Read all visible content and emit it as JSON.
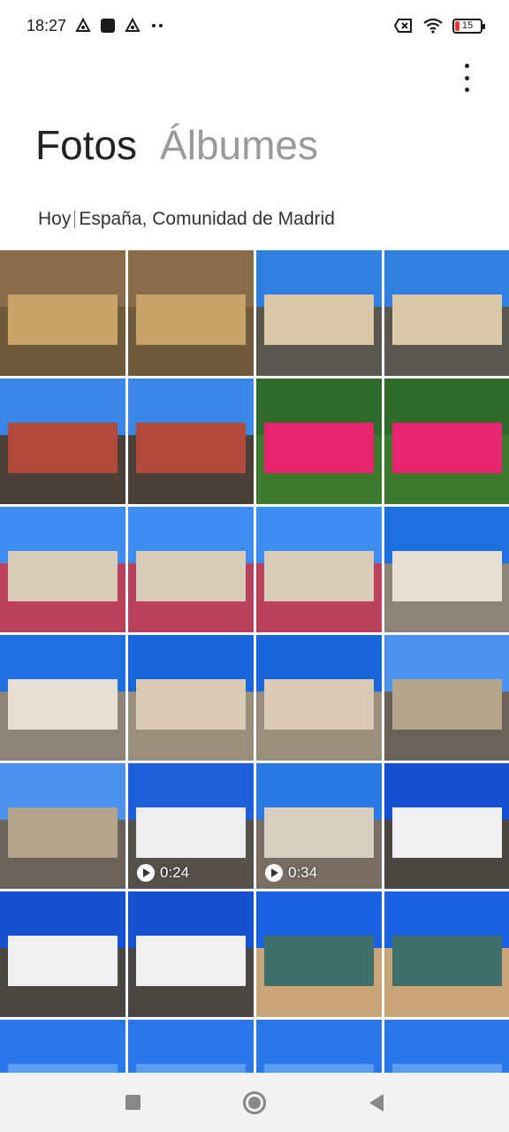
{
  "status_bar": {
    "time": "18:27",
    "battery_level": "15",
    "icons": [
      "notification-a-icon",
      "app-square-icon",
      "notification-a-icon",
      "more-dots-icon",
      "sim-off-icon",
      "wifi-icon",
      "battery-icon"
    ]
  },
  "header": {
    "more_menu_icon": "more-vertical-icon"
  },
  "tabs": [
    {
      "label": "Fotos",
      "active": true
    },
    {
      "label": "Álbumes",
      "active": false
    }
  ],
  "section": {
    "date": "Hoy",
    "location": "España, Comunidad de Madrid"
  },
  "photos": [
    {
      "kind": "mirror-terrace",
      "video_duration": ""
    },
    {
      "kind": "mirror-terrace",
      "video_duration": ""
    },
    {
      "kind": "street-buildings",
      "video_duration": ""
    },
    {
      "kind": "street-buildings",
      "video_duration": ""
    },
    {
      "kind": "street-restaurants",
      "video_duration": ""
    },
    {
      "kind": "street-restaurants",
      "video_duration": ""
    },
    {
      "kind": "pink-flowers",
      "video_duration": ""
    },
    {
      "kind": "pink-flowers",
      "video_duration": ""
    },
    {
      "kind": "plaza-garden",
      "video_duration": ""
    },
    {
      "kind": "plaza-garden",
      "video_duration": ""
    },
    {
      "kind": "plaza-garden",
      "video_duration": ""
    },
    {
      "kind": "palace",
      "video_duration": ""
    },
    {
      "kind": "palace",
      "video_duration": ""
    },
    {
      "kind": "theatre",
      "video_duration": ""
    },
    {
      "kind": "theatre",
      "video_duration": ""
    },
    {
      "kind": "street-crowd",
      "video_duration": ""
    },
    {
      "kind": "street-crowd",
      "video_duration": ""
    },
    {
      "kind": "white-building",
      "video_duration": "0:24"
    },
    {
      "kind": "fountain-square",
      "video_duration": "0:34"
    },
    {
      "kind": "tio-pepe",
      "video_duration": ""
    },
    {
      "kind": "tio-pepe",
      "video_duration": ""
    },
    {
      "kind": "tio-pepe",
      "video_duration": ""
    },
    {
      "kind": "statue",
      "video_duration": ""
    },
    {
      "kind": "statue",
      "video_duration": ""
    },
    {
      "kind": "blue-sky",
      "video_duration": ""
    },
    {
      "kind": "blue-sky",
      "video_duration": ""
    },
    {
      "kind": "blue-sky",
      "video_duration": ""
    },
    {
      "kind": "blue-sky",
      "video_duration": ""
    }
  ],
  "palettes": {
    "mirror-terrace": {
      "sky": "#8a6b4a",
      "bldg": "#c9a46a",
      "ground": "#6f5a3c"
    },
    "street-buildings": {
      "sky": "#2f7fe0",
      "bldg": "#d8c8a8",
      "ground": "#5a5650"
    },
    "street-restaurants": {
      "sky": "#3a86e8",
      "bldg": "#b24a3c",
      "ground": "#4a4038"
    },
    "pink-flowers": {
      "sky": "#2f6b2a",
      "bldg": "#e8246e",
      "ground": "#3d7a30"
    },
    "plaza-garden": {
      "sky": "#3d8ef0",
      "bldg": "#d7cdb8",
      "ground": "#b8405a"
    },
    "palace": {
      "sky": "#1e6fe0",
      "bldg": "#e6e0d4",
      "ground": "#8c8478"
    },
    "theatre": {
      "sky": "#1a66dd",
      "bldg": "#d9cbb3",
      "ground": "#9a8e7c"
    },
    "street-crowd": {
      "sky": "#4b93ec",
      "bldg": "#b3a48c",
      "ground": "#6a625a"
    },
    "white-building": {
      "sky": "#1c5fd8",
      "bldg": "#eeeeee",
      "ground": "#55504a"
    },
    "fountain-square": {
      "sky": "#2a7ae6",
      "bldg": "#d8cfc0",
      "ground": "#7a6e62"
    },
    "tio-pepe": {
      "sky": "#1450d0",
      "bldg": "#f0f0f0",
      "ground": "#4a4642"
    },
    "statue": {
      "sky": "#1a62e0",
      "bldg": "#3f6f68",
      "ground": "#c9a67a"
    },
    "blue-sky": {
      "sky": "#2b78ea",
      "bldg": "#5b9ff2",
      "ground": "#2f74e4"
    }
  },
  "nav_bar": {
    "buttons": [
      "recents-square-icon",
      "home-circle-icon",
      "back-triangle-icon"
    ]
  }
}
